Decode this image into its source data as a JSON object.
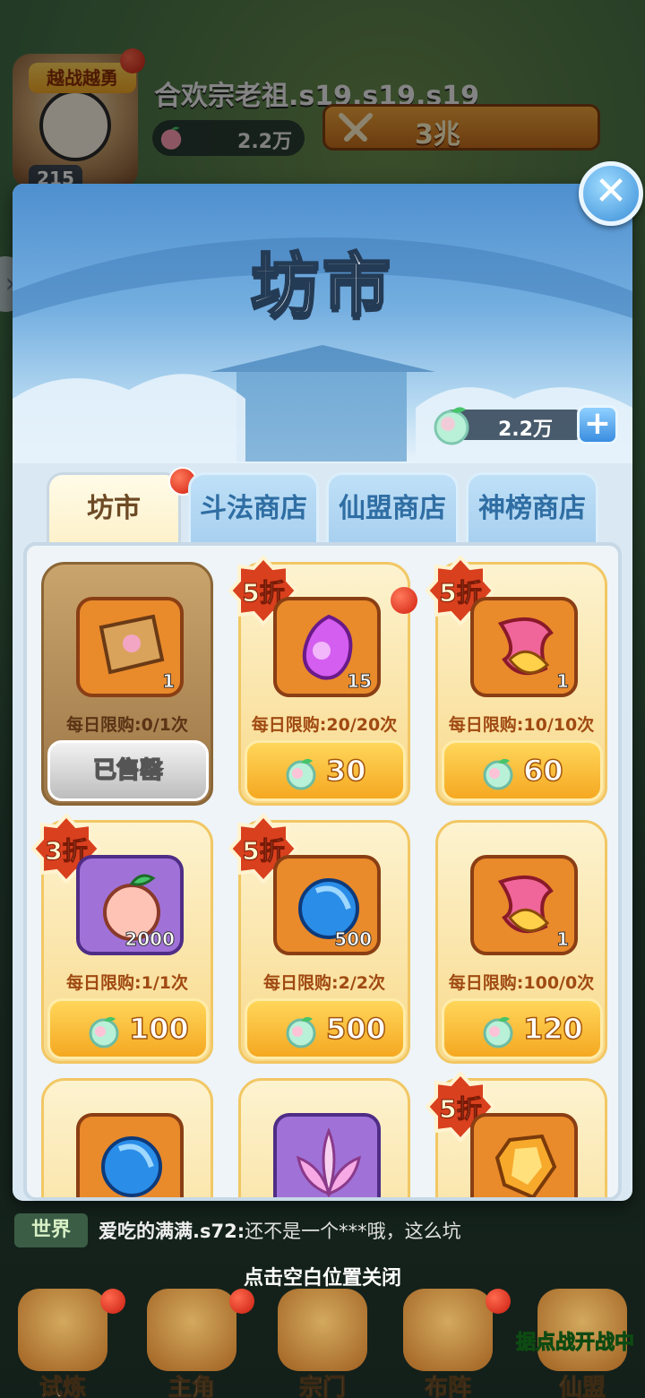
{
  "player": {
    "avatar_banner": "越战越勇",
    "level": "215",
    "name": "合欢宗老祖.s19.s19.s19",
    "gems": "2.2万",
    "power": "3兆"
  },
  "modal": {
    "title": "坊市",
    "currency_value": "2.2万",
    "plus_label": "+",
    "close_label": "✕"
  },
  "tabs": [
    {
      "label": "坊市",
      "active": true
    },
    {
      "label": "斗法商店",
      "active": false
    },
    {
      "label": "仙盟商店",
      "active": false
    },
    {
      "label": "神榜商店",
      "active": false
    }
  ],
  "items": [
    {
      "name": "scroll",
      "qty": "1",
      "limit": "每日限购:0/1次",
      "sold_label": "已售罄",
      "discount": "",
      "price": ""
    },
    {
      "name": "purple-spirit",
      "qty": "15",
      "limit": "每日限购:20/20次",
      "discount": "5折",
      "price": "30"
    },
    {
      "name": "phoenix-feather",
      "qty": "1",
      "limit": "每日限购:10/10次",
      "discount": "5折",
      "price": "60"
    },
    {
      "name": "peach",
      "qty": "2000",
      "limit": "每日限购:1/1次",
      "discount": "3折",
      "price": "100"
    },
    {
      "name": "blue-orb",
      "qty": "500",
      "limit": "每日限购:2/2次",
      "discount": "5折",
      "price": "500"
    },
    {
      "name": "phoenix-feather",
      "qty": "1",
      "limit": "每日限购:100/0次",
      "discount": "",
      "price": "120"
    },
    {
      "name": "blue-orb",
      "qty": "",
      "limit": "",
      "discount": "",
      "price": ""
    },
    {
      "name": "lotus",
      "qty": "",
      "limit": "",
      "discount": "",
      "price": ""
    },
    {
      "name": "gold-crystal",
      "qty": "",
      "limit": "",
      "discount": "5折",
      "price": ""
    }
  ],
  "chat": {
    "channel": "世界",
    "sender": "爱吃的满满.s72:",
    "text": "还不是一个***哦，这么坑"
  },
  "hint": "点击空白位置关闭",
  "nav": [
    {
      "label": "试炼"
    },
    {
      "label": "主角"
    },
    {
      "label": "宗门"
    },
    {
      "label": "布阵"
    },
    {
      "label": "仙盟"
    }
  ],
  "nav_note": "据点战开战中",
  "colors": {
    "accent_gold": "#f5a821",
    "discount_red": "#d9401e",
    "tab_active": "#fdf1c9",
    "tab_inactive": "#a7cfef"
  }
}
